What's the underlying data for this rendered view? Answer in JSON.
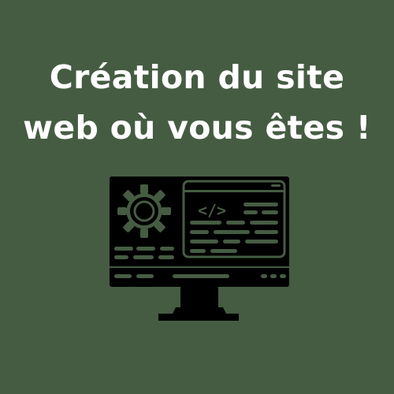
{
  "headline": {
    "line1": "Création du site",
    "line2": "web où vous êtes !"
  },
  "illustration": {
    "icon": "computer-monitor-code-gear-icon",
    "code_glyph": "</>"
  },
  "colors": {
    "background": "#455c42",
    "text": "#ffffff",
    "icon": "#000000"
  }
}
